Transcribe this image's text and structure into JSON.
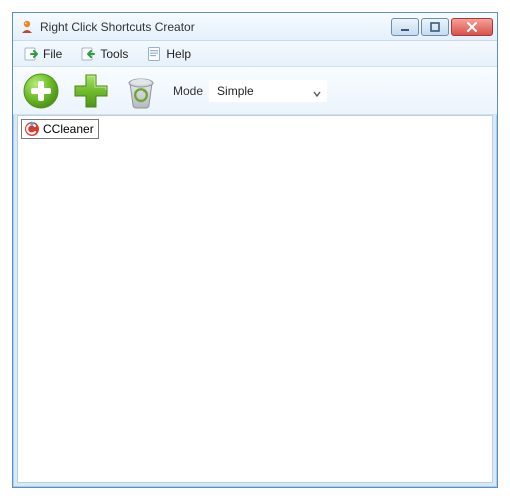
{
  "titlebar": {
    "title": "Right Click Shortcuts Creator"
  },
  "menubar": {
    "file": "File",
    "tools": "Tools",
    "help": "Help"
  },
  "toolbar": {
    "mode_label": "Mode",
    "mode_value": "Simple"
  },
  "list": {
    "items": [
      {
        "label": "CCleaner"
      }
    ]
  },
  "colors": {
    "accent_green": "#6fbc2a",
    "accent_orange": "#e68a1f",
    "close_red": "#d9534a"
  }
}
